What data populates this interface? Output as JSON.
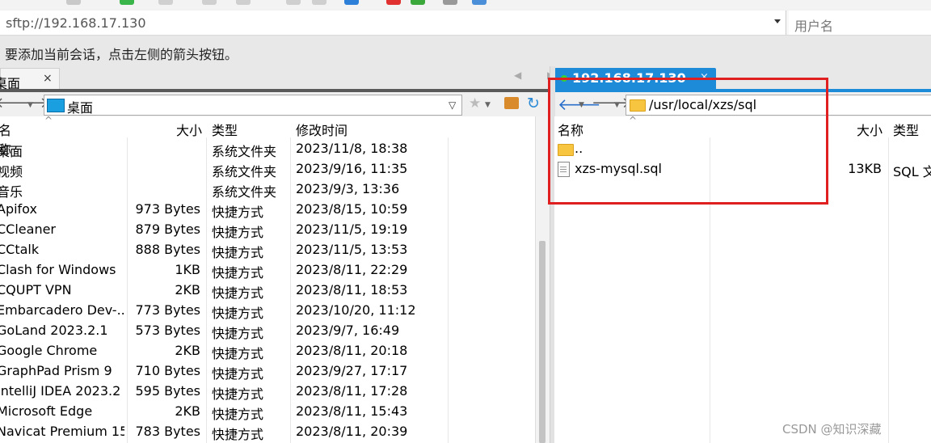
{
  "address_bar": {
    "value": "sftp://192.168.17.130",
    "user_placeholder": "用户名"
  },
  "hint": "要添加当前会话，点击左侧的箭头按钮。",
  "tabs": {
    "left": {
      "label": "桌面",
      "close": "×"
    },
    "right": {
      "label": "192.168.17.130",
      "close": "×"
    },
    "scroll_arrows": "◀ ▶"
  },
  "left_pane": {
    "path": "桌面",
    "columns": {
      "name": "名称",
      "size": "大小",
      "type": "类型",
      "modified": "修改时间"
    },
    "rows": [
      {
        "name": "桌面",
        "size": "",
        "type": "系统文件夹",
        "modified": "2023/11/8, 18:38"
      },
      {
        "name": "视频",
        "size": "",
        "type": "系统文件夹",
        "modified": "2023/9/16, 11:35"
      },
      {
        "name": "音乐",
        "size": "",
        "type": "系统文件夹",
        "modified": "2023/9/3, 13:36"
      },
      {
        "name": "Apifox",
        "size": "973 Bytes",
        "type": "快捷方式",
        "modified": "2023/8/15, 10:59"
      },
      {
        "name": "CCleaner",
        "size": "879 Bytes",
        "type": "快捷方式",
        "modified": "2023/11/5, 19:19"
      },
      {
        "name": "CCtalk",
        "size": "888 Bytes",
        "type": "快捷方式",
        "modified": "2023/11/5, 13:53"
      },
      {
        "name": "Clash for Windows",
        "size": "1KB",
        "type": "快捷方式",
        "modified": "2023/8/11, 22:29"
      },
      {
        "name": "CQUPT VPN",
        "size": "2KB",
        "type": "快捷方式",
        "modified": "2023/8/11, 18:53"
      },
      {
        "name": "Embarcadero Dev-...",
        "size": "773 Bytes",
        "type": "快捷方式",
        "modified": "2023/10/20, 11:12"
      },
      {
        "name": "GoLand 2023.2.1",
        "size": "573 Bytes",
        "type": "快捷方式",
        "modified": "2023/9/7, 16:49"
      },
      {
        "name": "Google Chrome",
        "size": "2KB",
        "type": "快捷方式",
        "modified": "2023/8/11, 20:18"
      },
      {
        "name": "GraphPad Prism 9",
        "size": "710 Bytes",
        "type": "快捷方式",
        "modified": "2023/9/27, 17:17"
      },
      {
        "name": "IntelliJ IDEA 2023.2",
        "size": "595 Bytes",
        "type": "快捷方式",
        "modified": "2023/8/11, 17:28"
      },
      {
        "name": "Microsoft Edge",
        "size": "2KB",
        "type": "快捷方式",
        "modified": "2023/8/11, 15:43"
      },
      {
        "name": "Navicat Premium 15",
        "size": "783 Bytes",
        "type": "快捷方式",
        "modified": "2023/8/11, 20:39"
      }
    ]
  },
  "right_pane": {
    "path": "/usr/local/xzs/sql",
    "columns": {
      "name": "名称",
      "size": "大小",
      "type": "类型"
    },
    "rows": [
      {
        "name": "..",
        "size": "",
        "type": "",
        "icon": "folder-icon"
      },
      {
        "name": "xzs-mysql.sql",
        "size": "13KB",
        "type": "SQL 文",
        "icon": "file-icon"
      }
    ]
  },
  "watermark": "CSDN @知识深藏",
  "colors": {
    "tab_active": "#1e8bd9",
    "annotation": "#e02020",
    "folder": "#f7c540"
  }
}
